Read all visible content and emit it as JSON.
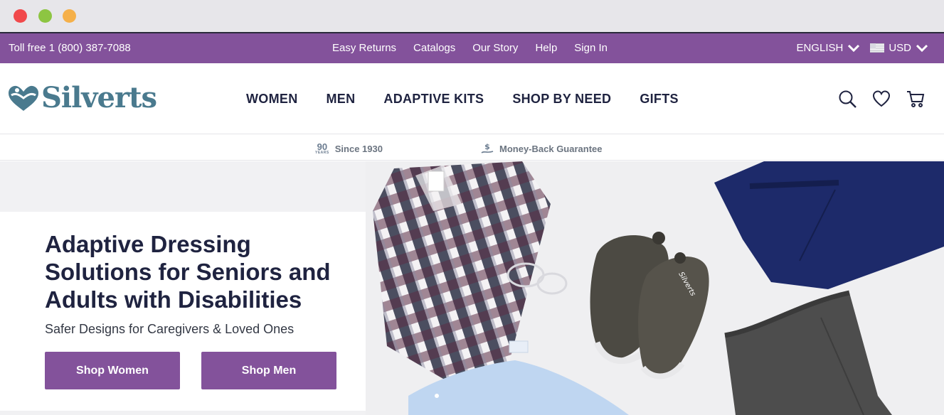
{
  "utility": {
    "phone": "Toll free 1 (800) 387-7088",
    "links": [
      "Easy Returns",
      "Catalogs",
      "Our Story",
      "Help",
      "Sign In"
    ],
    "language": "ENGLISH",
    "currency": "USD"
  },
  "brand": {
    "name": "Silverts",
    "color": "#4a7a8e"
  },
  "nav": [
    "WOMEN",
    "MEN",
    "ADAPTIVE KITS",
    "SHOP BY NEED",
    "GIFTS"
  ],
  "header_icons": [
    "search-icon",
    "heart-icon",
    "cart-icon"
  ],
  "badges": {
    "years_number": "90",
    "years_word": "YEARS",
    "since": "Since 1930",
    "guarantee": "Money-Back Guarantee"
  },
  "hero": {
    "title": "Adaptive Dressing Solutions for Seniors and Adults with Disabilities",
    "subtitle": "Safer Designs for Caregivers & Loved Ones",
    "shop_women": "Shop Women",
    "shop_men": "Shop Men",
    "image_text": "Silverts"
  },
  "colors": {
    "accent": "#83529b",
    "navy": "#1f2340",
    "chrome": "#e7e6ea"
  }
}
